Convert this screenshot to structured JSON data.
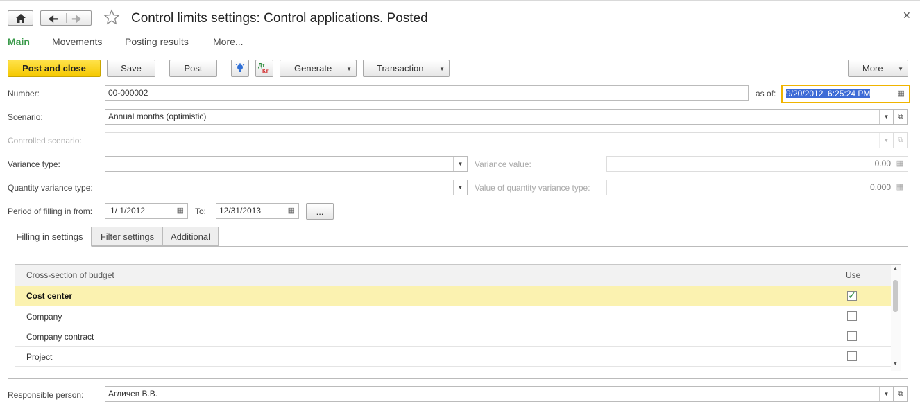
{
  "header": {
    "title": "Control limits settings: Control applications. Posted",
    "close_icon": "close-icon",
    "home_icon": "home-icon",
    "back_icon": "arrow-left-icon",
    "forward_icon": "arrow-right-icon",
    "star_icon": "star-icon"
  },
  "section_tabs": [
    {
      "label": "Main",
      "active": true
    },
    {
      "label": "Movements"
    },
    {
      "label": "Posting results"
    },
    {
      "label": "More..."
    }
  ],
  "toolbar": {
    "post_and_close": "Post and close",
    "save": "Save",
    "post": "Post",
    "generate": "Generate",
    "transaction": "Transaction",
    "more": "More",
    "bulb_icon": "lightbulb-icon",
    "dtkt_icon": "dt-kt-icon",
    "dt_text": "Дт",
    "kt_text": "Кт"
  },
  "form": {
    "number_label": "Number:",
    "number_value": "00-000002",
    "as_of_label": "as of:",
    "as_of_value": "9/20/2012  6:25:24 PM",
    "scenario_label": "Scenario:",
    "scenario_value": "Annual months (optimistic)",
    "controlled_scenario_label": "Controlled scenario:",
    "controlled_scenario_value": "",
    "variance_type_label": "Variance type:",
    "variance_type_value": "",
    "variance_value_label": "Variance value:",
    "variance_value": "0.00",
    "qty_variance_type_label": "Quantity variance type:",
    "qty_variance_type_value": "",
    "qty_variance_value_label": "Value of quantity variance type:",
    "qty_variance_value": "0.000",
    "period_label": "Period of filling in from:",
    "period_from": "1/ 1/2012",
    "to_label": "To:",
    "period_to": "12/31/2013",
    "ellipsis": "...",
    "responsible_label": "Responsible person:",
    "responsible_value": "Агличев В.В."
  },
  "inner_tabs": [
    {
      "label": "Filling in settings",
      "active": true
    },
    {
      "label": "Filter settings"
    },
    {
      "label": "Additional"
    }
  ],
  "table": {
    "columns": [
      "Cross-section of budget",
      "Use"
    ],
    "rows": [
      {
        "name": "Cost center",
        "use": true,
        "selected": true
      },
      {
        "name": "Company",
        "use": false
      },
      {
        "name": "Company contract",
        "use": false
      },
      {
        "name": "Project",
        "use": false
      }
    ]
  },
  "colors": {
    "accent_green": "#3a9a4a",
    "primary_button": "#f5c800",
    "selected_row": "#fbf2b0",
    "focus_border": "#f0b400",
    "date_selection": "#3d6bd6"
  }
}
